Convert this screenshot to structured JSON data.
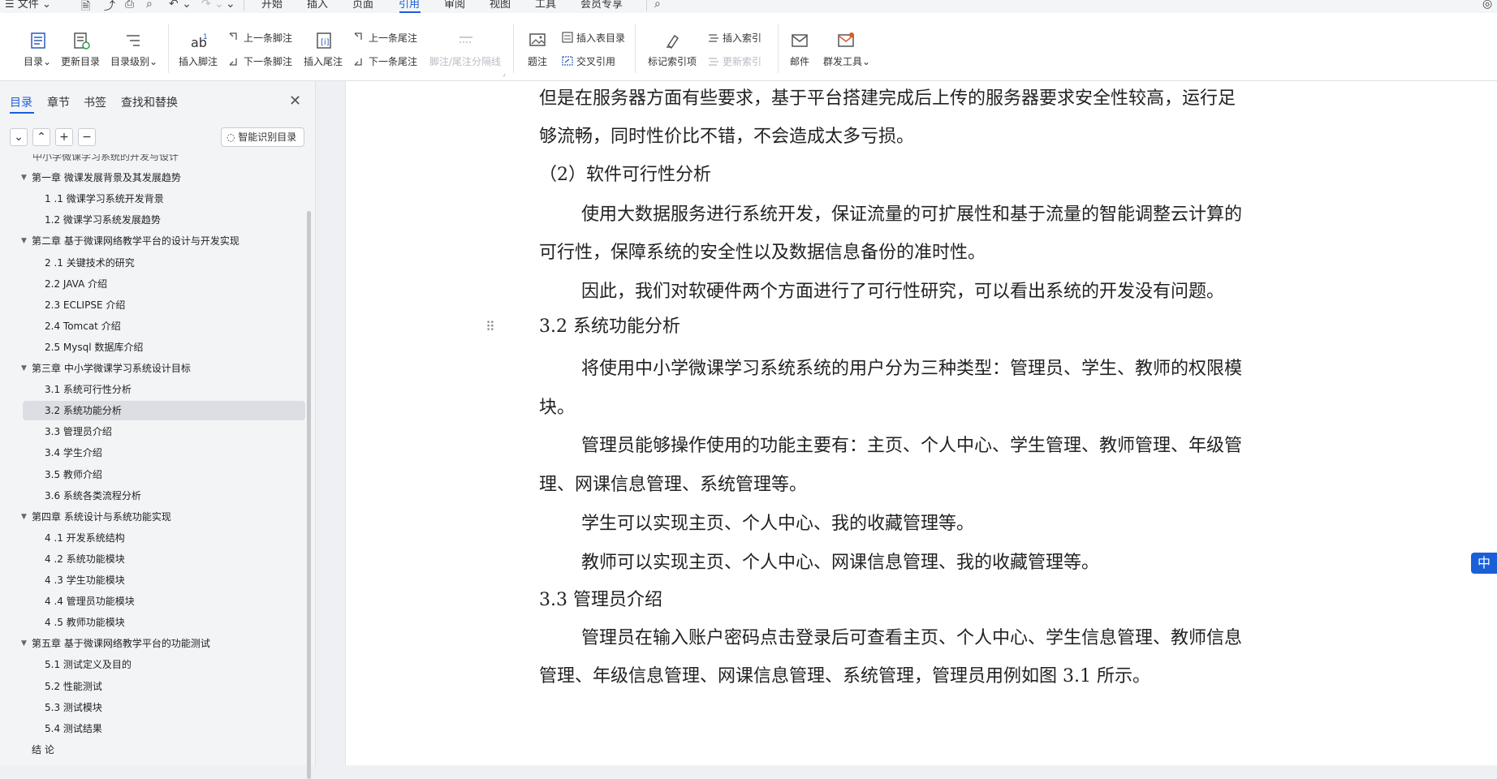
{
  "menubar": {
    "file": "文件",
    "tabs": [
      "开始",
      "插入",
      "页面",
      "引用",
      "审阅",
      "视图",
      "工具",
      "会员专享"
    ],
    "active_tab": "引用"
  },
  "ribbon": {
    "toc": "目录",
    "update_toc": "更新目录",
    "toc_level": "目录级别",
    "insert_footnote": "插入脚注",
    "prev_footnote": "上一条脚注",
    "next_footnote": "下一条脚注",
    "insert_endnote": "插入尾注",
    "prev_endnote": "上一条尾注",
    "next_endnote": "下一条尾注",
    "separator_line": "脚注/尾注分隔线",
    "caption": "题注",
    "insert_table_of_figures": "插入表目录",
    "cross_reference": "交叉引用",
    "mark_index_entry": "标记索引项",
    "insert_index": "插入索引",
    "update_index": "更新索引",
    "mail": "邮件",
    "mass_mail_tools": "群发工具"
  },
  "sidebar": {
    "tabs": [
      "目录",
      "章节",
      "书签",
      "查找和替换"
    ],
    "active_tab": "目录",
    "controls": {
      "collapse": "⌄",
      "up": "⌃",
      "add": "+",
      "remove": "−"
    },
    "smart_button": "智能识别目录",
    "toc_items": [
      {
        "text": "中小学微课学习系统的开发与设计",
        "level": 0,
        "partial": true
      },
      {
        "text": "第一章   微课发展背景及其发展趋势",
        "level": 1
      },
      {
        "text": "1 .1  微课学习系统开发背景",
        "level": 2
      },
      {
        "text": "1.2  微课学习系统发展趋势",
        "level": 2
      },
      {
        "text": "第二章   基于微课网络教学平台的设计与开发实现",
        "level": 1
      },
      {
        "text": "2 .1  关键技术的研究",
        "level": 2
      },
      {
        "text": "2.2 JAVA 介绍",
        "level": 2
      },
      {
        "text": "2.3 ECLIPSE 介绍",
        "level": 2
      },
      {
        "text": "2.4 Tomcat 介绍",
        "level": 2
      },
      {
        "text": "2.5 Mysql 数据库介绍",
        "level": 2
      },
      {
        "text": "第三章  中小学微课学习系统设计目标",
        "level": 1
      },
      {
        "text": "3.1  系统可行性分析",
        "level": 2
      },
      {
        "text": "3.2  系统功能分析",
        "level": 2,
        "selected": true
      },
      {
        "text": "3.3  管理员介绍",
        "level": 2
      },
      {
        "text": "3.4  学生介绍",
        "level": 2
      },
      {
        "text": "3.5 教师介绍",
        "level": 2
      },
      {
        "text": "3.6  系统各类流程分析",
        "level": 2
      },
      {
        "text": "第四章  系统设计与系统功能实现",
        "level": 1
      },
      {
        "text": "4 .1  开发系统结构",
        "level": 2
      },
      {
        "text": "4 .2  系统功能模块",
        "level": 2
      },
      {
        "text": "4 .3  学生功能模块",
        "level": 2
      },
      {
        "text": "4 .4  管理员功能模块",
        "level": 2
      },
      {
        "text": "4 .5 教师功能模块",
        "level": 2
      },
      {
        "text": "第五章  基于微课网络教学平台的功能测试",
        "level": 1
      },
      {
        "text": "5.1 测试定义及目的",
        "level": 2
      },
      {
        "text": "5.2 性能测试",
        "level": 2
      },
      {
        "text": "5.3 测试模块",
        "level": 2
      },
      {
        "text": "5.4 测试结果",
        "level": 2
      },
      {
        "text": "结  论",
        "level": 1,
        "no_arrow": true
      }
    ]
  },
  "document": {
    "lines": [
      {
        "text": "但是在服务器方面有些要求，基于平台搭建完成后上传的服务器要求安全性较高，运行足",
        "indent": false
      },
      {
        "text": "够流畅，同时性价比不错，不会造成太多亏损。",
        "indent": false
      },
      {
        "text": "（2）软件可行性分析",
        "indent": false
      },
      {
        "text": "使用大数据服务进行系统开发，保证流量的可扩展性和基于流量的智能调整云计算的",
        "indent": true
      },
      {
        "text": "可行性，保障系统的安全性以及数据信息备份的准时性。",
        "indent": false
      },
      {
        "text": "因此，我们对软硬件两个方面进行了可行性研究，可以看出系统的开发没有问题。",
        "indent": true
      },
      {
        "text": "3.2  系统功能分析",
        "indent": false
      },
      {
        "text": "将使用中小学微课学习系统系统的用户分为三种类型：管理员、学生、教师的权限模",
        "indent": true
      },
      {
        "text": "块。",
        "indent": false
      },
      {
        "text": "管理员能够操作使用的功能主要有：主页、个人中心、学生管理、教师管理、年级管",
        "indent": true
      },
      {
        "text": "理、网课信息管理、系统管理等。",
        "indent": false
      },
      {
        "text": "学生可以实现主页、个人中心、我的收藏管理等。",
        "indent": true
      },
      {
        "text": "教师可以实现主页、个人中心、网课信息管理、我的收藏管理等。",
        "indent": true
      },
      {
        "text": "3.3  管理员介绍",
        "indent": false
      },
      {
        "text": "管理员在输入账户密码点击登录后可查看主页、个人中心、学生信息管理、教师信息",
        "indent": true
      },
      {
        "text": "管理、年级信息管理、网课信息管理、系统管理，管理员用例如图 3.1 所示。",
        "indent": false
      }
    ]
  },
  "ime": "中",
  "colors": {
    "accent": "#1a5fd8",
    "selection": "#dcdee3"
  }
}
